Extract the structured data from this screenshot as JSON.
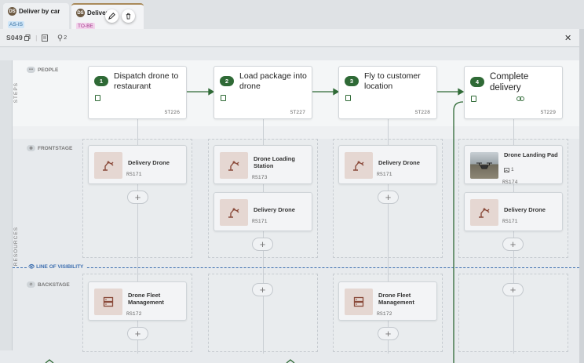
{
  "tabs": [
    {
      "initials": "DS",
      "title": "Deliver by car",
      "badge": "AS-IS"
    },
    {
      "initials": "DS",
      "title": "Delivery",
      "badge": "TO-BE"
    }
  ],
  "toolbar": {
    "code": "S049",
    "count": "2"
  },
  "rails": {
    "steps": "STEPS",
    "resources": "RESOURCES"
  },
  "lanes": {
    "people": "PEOPLE",
    "frontstage": "FRONTSTAGE",
    "visibility": "LINE OF VISIBILITY",
    "backstage": "BACKSTAGE"
  },
  "steps": [
    {
      "num": "1",
      "title": "Dispatch drone to restaurant",
      "code": "ST226"
    },
    {
      "num": "2",
      "title": "Load package into drone",
      "code": "ST227"
    },
    {
      "num": "3",
      "title": "Fly to customer location",
      "code": "ST228"
    },
    {
      "num": "4",
      "title": "Complete delivery",
      "code": "ST229"
    }
  ],
  "frontstage": [
    [
      {
        "name": "Delivery Drone",
        "code": "RS171"
      }
    ],
    [
      {
        "name": "Drone Loading Station",
        "code": "RS173"
      },
      {
        "name": "Delivery Drone",
        "code": "RS171"
      }
    ],
    [
      {
        "name": "Delivery Drone",
        "code": "RS171"
      }
    ],
    [
      {
        "name": "Drone Landing Pad",
        "code": "RS174",
        "count": "1"
      },
      {
        "name": "Delivery Drone",
        "code": "RS171"
      }
    ]
  ],
  "backstage": [
    {
      "name": "Drone Fleet Management",
      "code": "RS172"
    },
    {
      "name": "Drone Fleet Management",
      "code": "RS172"
    }
  ],
  "colors": {
    "accent": "#2f6a36",
    "visibility": "#3d6fb0",
    "tobe": "#a2398a",
    "asis": "#2f6a9c"
  },
  "icons": [
    "copy-icon",
    "document-icon",
    "pin-icon",
    "close-icon",
    "edit-icon",
    "trash-icon",
    "robot-arm-icon",
    "server-icon",
    "link-icon",
    "eye-icon",
    "people-icon",
    "eye-off-icon"
  ]
}
